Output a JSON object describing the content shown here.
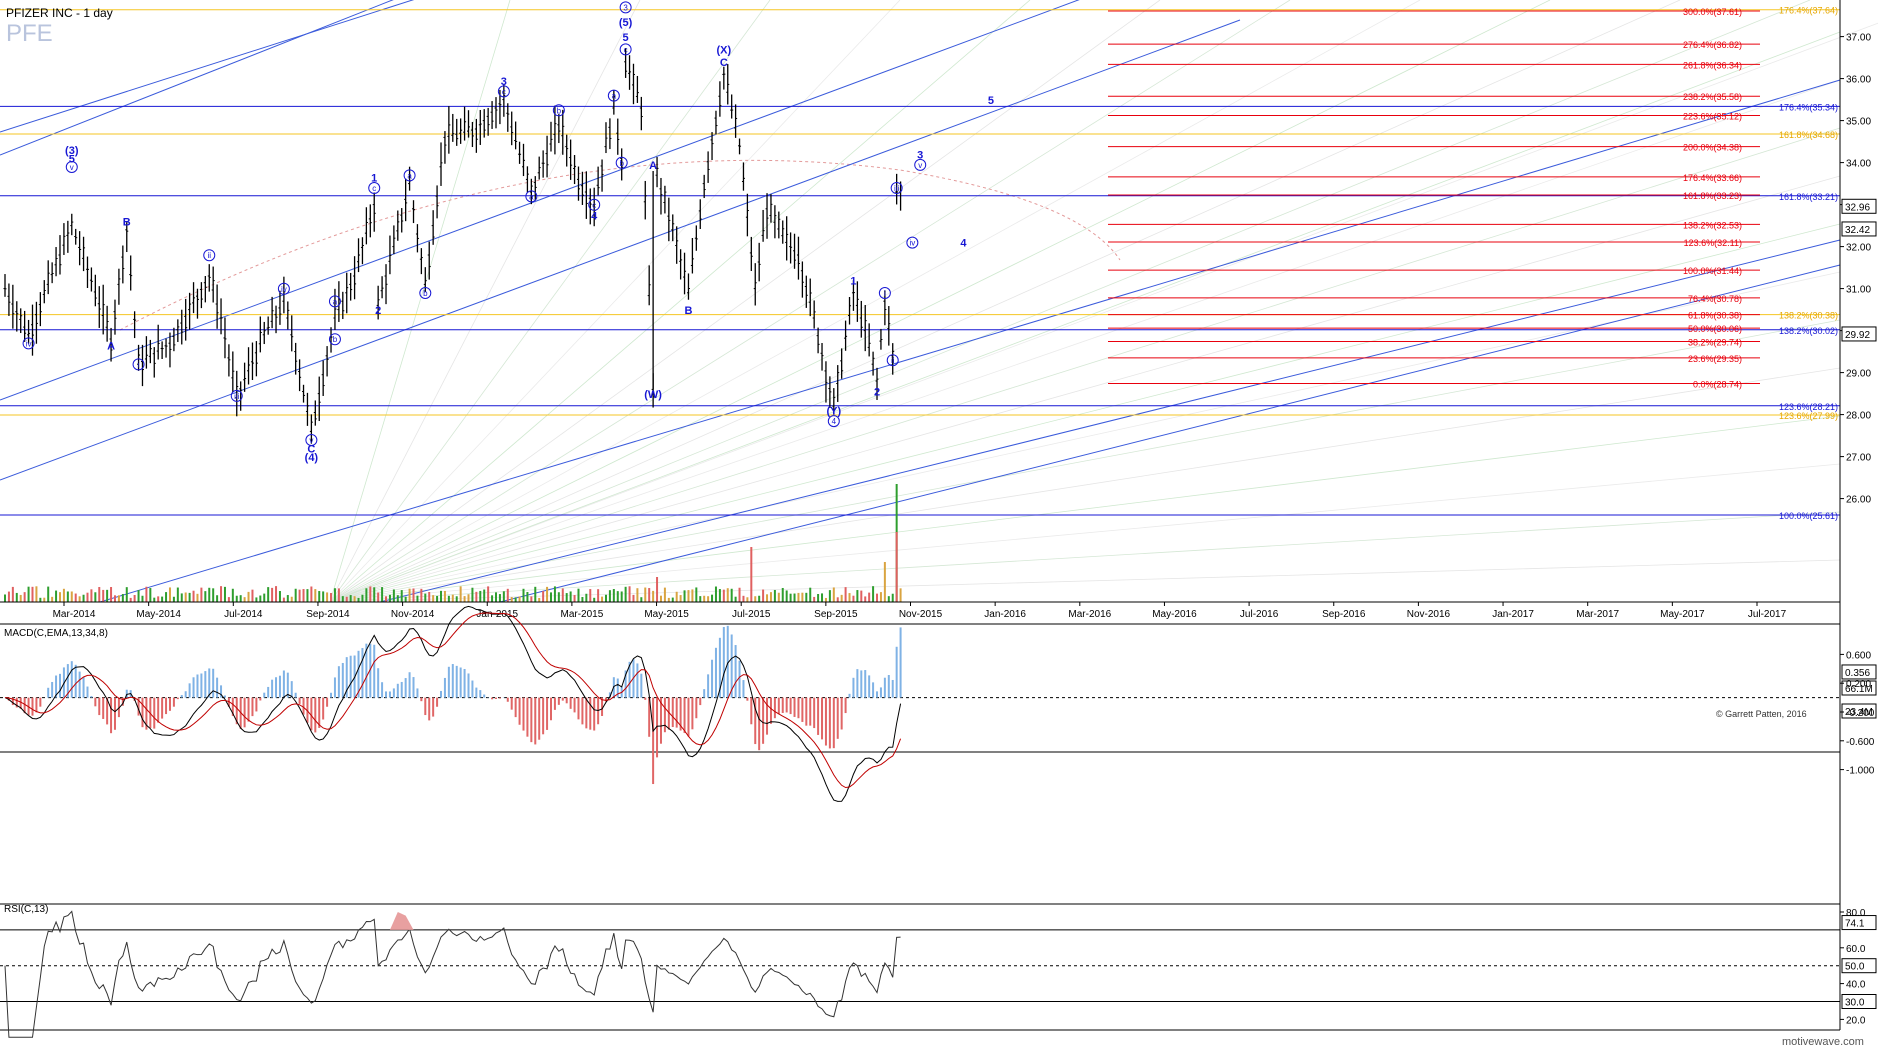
{
  "header": {
    "title": "PFIZER INC - 1 day",
    "symbol": "PFE"
  },
  "colors": {
    "blue": "#1717d4",
    "red": "#e8000d",
    "yellow": "#f5c623",
    "candle": "#000000",
    "macd_pos": "#7fb2e5",
    "macd_neg": "#e06666",
    "rsi_overbought": "#e8a0a0",
    "vol_up": "#2e9e2e",
    "vol_down": "#e06060",
    "vol_flat": "#d9a441"
  },
  "price_axis": {
    "labels": [
      "37.00",
      "36.00",
      "35.00",
      "34.00",
      "33.00",
      "32.00",
      "31.00",
      "30.00",
      "29.00",
      "28.00",
      "27.00",
      "26.00"
    ],
    "current_tags": [
      {
        "value": 32.96,
        "text": "32.96"
      },
      {
        "value": 32.42,
        "text": "32.42"
      },
      {
        "value": 29.92,
        "text": "29.92"
      }
    ],
    "volume_tags": [
      "66.1M",
      "23.4M"
    ]
  },
  "date_axis": {
    "labels": [
      "Mar-2014",
      "May-2014",
      "Jul-2014",
      "Sep-2014",
      "Nov-2014",
      "Jan-2015",
      "Mar-2015",
      "May-2015",
      "Jul-2015",
      "Sep-2015",
      "Nov-2015",
      "Jan-2016",
      "Mar-2016",
      "May-2016",
      "Jul-2016",
      "Sep-2016",
      "Nov-2016",
      "Jan-2017",
      "Mar-2017",
      "May-2017",
      "Jul-2017"
    ]
  },
  "fib_red": [
    {
      "value": 37.61,
      "text": "300.0%(37.61)"
    },
    {
      "value": 36.82,
      "text": "276.4%(36.82)"
    },
    {
      "value": 36.34,
      "text": "261.8%(36.34)"
    },
    {
      "value": 35.58,
      "text": "238.2%(35.58)"
    },
    {
      "value": 35.12,
      "text": "223.6%(35.12)"
    },
    {
      "value": 34.38,
      "text": "200.0%(34.38)"
    },
    {
      "value": 33.66,
      "text": "176.4%(33.66)"
    },
    {
      "value": 33.23,
      "text": "161.8%(33.23)"
    },
    {
      "value": 32.53,
      "text": "138.2%(32.53)"
    },
    {
      "value": 32.11,
      "text": "123.6%(32.11)"
    },
    {
      "value": 31.44,
      "text": "100.0%(31.44)"
    },
    {
      "value": 30.78,
      "text": "76.4%(30.78)"
    },
    {
      "value": 30.38,
      "text": "61.8%(30.38)"
    },
    {
      "value": 30.06,
      "text": "50.0%(30.06)"
    },
    {
      "value": 29.74,
      "text": "38.2%(29.74)"
    },
    {
      "value": 29.35,
      "text": "23.6%(29.35)"
    },
    {
      "value": 28.74,
      "text": "0.0%(28.74)"
    }
  ],
  "fib_yellow": [
    {
      "value": 37.64,
      "text": "176.4%(37.64)"
    },
    {
      "value": 34.68,
      "text": "161.8%(34.68)"
    },
    {
      "value": 30.38,
      "text": "138.2%(30.38)"
    },
    {
      "value": 27.99,
      "text": "123.6%(27.99)"
    }
  ],
  "fib_blue": [
    {
      "value": 35.34,
      "text": "176.4%(35.34)"
    },
    {
      "value": 33.21,
      "text": "161.8%(33.21)"
    },
    {
      "value": 30.02,
      "text": "138.2%(30.02)"
    },
    {
      "value": 28.21,
      "text": "123.6%(28.21)"
    },
    {
      "value": 25.61,
      "text": "100.0%(25.61)"
    }
  ],
  "wave_labels": [
    {
      "text": "(3)",
      "bi": 17,
      "v": 34.2
    },
    {
      "text": "5",
      "bi": 17,
      "v": 34.0
    },
    {
      "text": "v",
      "bi": 17,
      "v": 33.8,
      "circle": true
    },
    {
      "text": "iv",
      "bi": 6,
      "v": 29.6,
      "circle": true
    },
    {
      "text": "A",
      "bi": 27,
      "v": 29.55
    },
    {
      "text": "B",
      "bi": 31,
      "v": 32.5
    },
    {
      "text": "i",
      "bi": 34,
      "v": 29.1,
      "circle": true
    },
    {
      "text": "ii",
      "bi": 52,
      "v": 31.7,
      "circle": true
    },
    {
      "text": "iii",
      "bi": 59,
      "v": 28.35,
      "circle": true
    },
    {
      "text": "iv",
      "bi": 71,
      "v": 30.9,
      "circle": true
    },
    {
      "text": "v",
      "bi": 78,
      "v": 27.3,
      "circle": true
    },
    {
      "text": "C",
      "bi": 78,
      "v": 27.1
    },
    {
      "text": "(4)",
      "bi": 78,
      "v": 26.9
    },
    {
      "text": "a",
      "bi": 84,
      "v": 30.6,
      "circle": true
    },
    {
      "text": "b",
      "bi": 84,
      "v": 29.7,
      "circle": true
    },
    {
      "text": "1",
      "bi": 94,
      "v": 33.55
    },
    {
      "text": "c",
      "bi": 94,
      "v": 33.3,
      "circle": true
    },
    {
      "text": "2",
      "bi": 95,
      "v": 30.4
    },
    {
      "text": "a",
      "bi": 103,
      "v": 33.6,
      "circle": true
    },
    {
      "text": "b",
      "bi": 107,
      "v": 30.8,
      "circle": true
    },
    {
      "text": "3",
      "bi": 127,
      "v": 35.85
    },
    {
      "text": "c",
      "bi": 127,
      "v": 35.6,
      "circle": true
    },
    {
      "text": "b",
      "bi": 141,
      "v": 35.15,
      "circle": true
    },
    {
      "text": "a",
      "bi": 134,
      "v": 33.1,
      "circle": true
    },
    {
      "text": "c",
      "bi": 150,
      "v": 32.9,
      "circle": true
    },
    {
      "text": "4",
      "bi": 150,
      "v": 32.65
    },
    {
      "text": "a",
      "bi": 155,
      "v": 35.5,
      "circle": true
    },
    {
      "text": "b",
      "bi": 157,
      "v": 33.9,
      "circle": true
    },
    {
      "text": "3",
      "bi": 158,
      "v": 37.6,
      "circle": true
    },
    {
      "text": "(5)",
      "bi": 158,
      "v": 37.25
    },
    {
      "text": "5",
      "bi": 158,
      "v": 36.9
    },
    {
      "text": "c",
      "bi": 158,
      "v": 36.6,
      "circle": true
    },
    {
      "text": "A",
      "bi": 165,
      "v": 33.85
    },
    {
      "text": "(W)",
      "bi": 165,
      "v": 28.4
    },
    {
      "text": "B",
      "bi": 174,
      "v": 30.4
    },
    {
      "text": "(X)",
      "bi": 183,
      "v": 36.6
    },
    {
      "text": "C",
      "bi": 183,
      "v": 36.3
    },
    {
      "text": "1",
      "bi": 216,
      "v": 31.1
    },
    {
      "text": "(Y)",
      "bi": 211,
      "v": 28.0
    },
    {
      "text": "4",
      "bi": 211,
      "v": 27.75,
      "circle": true
    },
    {
      "text": "2",
      "bi": 222,
      "v": 28.45
    },
    {
      "text": "i",
      "bi": 224,
      "v": 30.8,
      "circle": true
    },
    {
      "text": "ii",
      "bi": 226,
      "v": 29.2,
      "circle": true
    },
    {
      "text": "iii",
      "bi": 227,
      "v": 33.3,
      "circle": true
    },
    {
      "text": "iv",
      "bi": 231,
      "v": 32.0,
      "circle": true
    },
    {
      "text": "3",
      "bi": 233,
      "v": 34.1
    },
    {
      "text": "v",
      "bi": 233,
      "v": 33.85,
      "circle": true
    },
    {
      "text": "4",
      "bi": 244,
      "v": 32.0
    },
    {
      "text": "5",
      "bi": 251,
      "v": 35.4
    }
  ],
  "macd": {
    "title": "MACD(C,EMA,13,34,8)",
    "labels": [
      "0.600",
      "0.200",
      "-0.200",
      "-0.600",
      "-1.000"
    ],
    "tag": "0.356"
  },
  "rsi": {
    "title": "RSI(C,13)",
    "labels": [
      "80.0",
      "60.0",
      "40.0",
      "20.0"
    ],
    "tags": [
      "74.1",
      "50.0",
      "30.0"
    ]
  },
  "copyright": "© Garrett Patten, 2016",
  "watermark": "motivewave.com"
}
